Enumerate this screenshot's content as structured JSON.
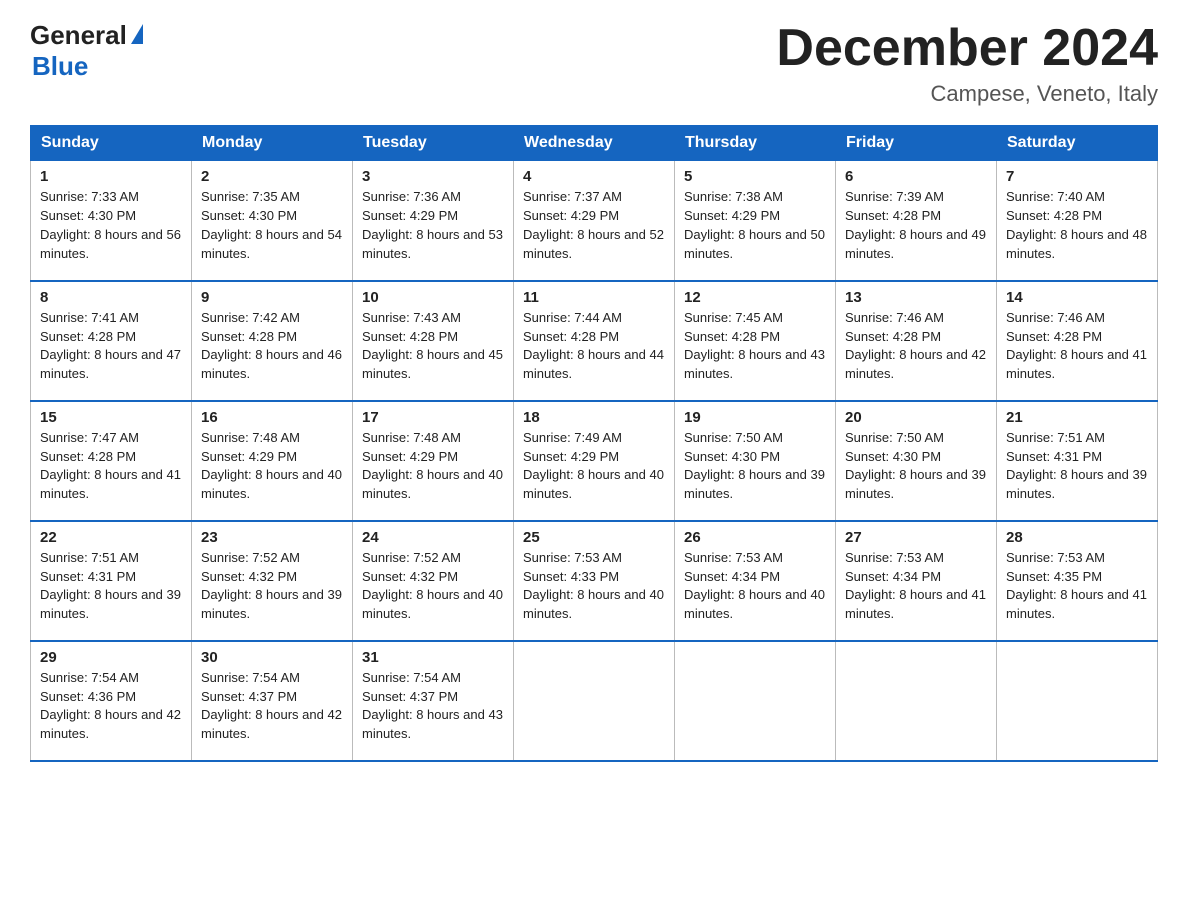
{
  "header": {
    "logo_general": "General",
    "logo_blue": "Blue",
    "month_title": "December 2024",
    "location": "Campese, Veneto, Italy"
  },
  "days_of_week": [
    "Sunday",
    "Monday",
    "Tuesday",
    "Wednesday",
    "Thursday",
    "Friday",
    "Saturday"
  ],
  "weeks": [
    [
      {
        "day": "1",
        "sunrise": "7:33 AM",
        "sunset": "4:30 PM",
        "daylight": "8 hours and 56 minutes."
      },
      {
        "day": "2",
        "sunrise": "7:35 AM",
        "sunset": "4:30 PM",
        "daylight": "8 hours and 54 minutes."
      },
      {
        "day": "3",
        "sunrise": "7:36 AM",
        "sunset": "4:29 PM",
        "daylight": "8 hours and 53 minutes."
      },
      {
        "day": "4",
        "sunrise": "7:37 AM",
        "sunset": "4:29 PM",
        "daylight": "8 hours and 52 minutes."
      },
      {
        "day": "5",
        "sunrise": "7:38 AM",
        "sunset": "4:29 PM",
        "daylight": "8 hours and 50 minutes."
      },
      {
        "day": "6",
        "sunrise": "7:39 AM",
        "sunset": "4:28 PM",
        "daylight": "8 hours and 49 minutes."
      },
      {
        "day": "7",
        "sunrise": "7:40 AM",
        "sunset": "4:28 PM",
        "daylight": "8 hours and 48 minutes."
      }
    ],
    [
      {
        "day": "8",
        "sunrise": "7:41 AM",
        "sunset": "4:28 PM",
        "daylight": "8 hours and 47 minutes."
      },
      {
        "day": "9",
        "sunrise": "7:42 AM",
        "sunset": "4:28 PM",
        "daylight": "8 hours and 46 minutes."
      },
      {
        "day": "10",
        "sunrise": "7:43 AM",
        "sunset": "4:28 PM",
        "daylight": "8 hours and 45 minutes."
      },
      {
        "day": "11",
        "sunrise": "7:44 AM",
        "sunset": "4:28 PM",
        "daylight": "8 hours and 44 minutes."
      },
      {
        "day": "12",
        "sunrise": "7:45 AM",
        "sunset": "4:28 PM",
        "daylight": "8 hours and 43 minutes."
      },
      {
        "day": "13",
        "sunrise": "7:46 AM",
        "sunset": "4:28 PM",
        "daylight": "8 hours and 42 minutes."
      },
      {
        "day": "14",
        "sunrise": "7:46 AM",
        "sunset": "4:28 PM",
        "daylight": "8 hours and 41 minutes."
      }
    ],
    [
      {
        "day": "15",
        "sunrise": "7:47 AM",
        "sunset": "4:28 PM",
        "daylight": "8 hours and 41 minutes."
      },
      {
        "day": "16",
        "sunrise": "7:48 AM",
        "sunset": "4:29 PM",
        "daylight": "8 hours and 40 minutes."
      },
      {
        "day": "17",
        "sunrise": "7:48 AM",
        "sunset": "4:29 PM",
        "daylight": "8 hours and 40 minutes."
      },
      {
        "day": "18",
        "sunrise": "7:49 AM",
        "sunset": "4:29 PM",
        "daylight": "8 hours and 40 minutes."
      },
      {
        "day": "19",
        "sunrise": "7:50 AM",
        "sunset": "4:30 PM",
        "daylight": "8 hours and 39 minutes."
      },
      {
        "day": "20",
        "sunrise": "7:50 AM",
        "sunset": "4:30 PM",
        "daylight": "8 hours and 39 minutes."
      },
      {
        "day": "21",
        "sunrise": "7:51 AM",
        "sunset": "4:31 PM",
        "daylight": "8 hours and 39 minutes."
      }
    ],
    [
      {
        "day": "22",
        "sunrise": "7:51 AM",
        "sunset": "4:31 PM",
        "daylight": "8 hours and 39 minutes."
      },
      {
        "day": "23",
        "sunrise": "7:52 AM",
        "sunset": "4:32 PM",
        "daylight": "8 hours and 39 minutes."
      },
      {
        "day": "24",
        "sunrise": "7:52 AM",
        "sunset": "4:32 PM",
        "daylight": "8 hours and 40 minutes."
      },
      {
        "day": "25",
        "sunrise": "7:53 AM",
        "sunset": "4:33 PM",
        "daylight": "8 hours and 40 minutes."
      },
      {
        "day": "26",
        "sunrise": "7:53 AM",
        "sunset": "4:34 PM",
        "daylight": "8 hours and 40 minutes."
      },
      {
        "day": "27",
        "sunrise": "7:53 AM",
        "sunset": "4:34 PM",
        "daylight": "8 hours and 41 minutes."
      },
      {
        "day": "28",
        "sunrise": "7:53 AM",
        "sunset": "4:35 PM",
        "daylight": "8 hours and 41 minutes."
      }
    ],
    [
      {
        "day": "29",
        "sunrise": "7:54 AM",
        "sunset": "4:36 PM",
        "daylight": "8 hours and 42 minutes."
      },
      {
        "day": "30",
        "sunrise": "7:54 AM",
        "sunset": "4:37 PM",
        "daylight": "8 hours and 42 minutes."
      },
      {
        "day": "31",
        "sunrise": "7:54 AM",
        "sunset": "4:37 PM",
        "daylight": "8 hours and 43 minutes."
      },
      null,
      null,
      null,
      null
    ]
  ],
  "accent_color": "#1565c0"
}
